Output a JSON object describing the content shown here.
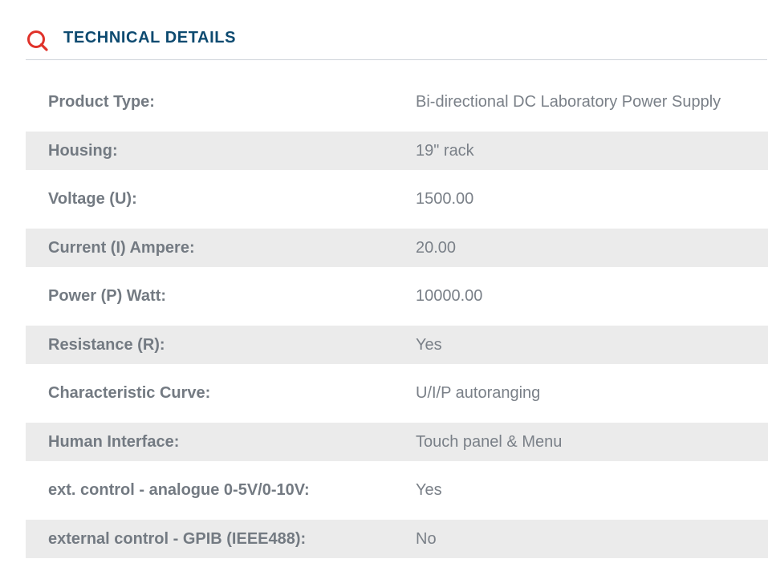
{
  "header": {
    "title": "TECHNICAL DETAILS",
    "icon": "search-icon",
    "icon_color": "#e0322a",
    "title_color": "#0d4a70"
  },
  "details": [
    {
      "label": "Product Type:",
      "value": "Bi-directional DC Laboratory Power Supply"
    },
    {
      "label": "Housing:",
      "value": "19\" rack"
    },
    {
      "label": "Voltage (U):",
      "value": "1500.00"
    },
    {
      "label": "Current (I) Ampere:",
      "value": "20.00"
    },
    {
      "label": "Power (P) Watt:",
      "value": "10000.00"
    },
    {
      "label": "Resistance (R):",
      "value": "Yes"
    },
    {
      "label": "Characteristic Curve:",
      "value": "U/I/P autoranging"
    },
    {
      "label": "Human Interface:",
      "value": "Touch panel & Menu"
    },
    {
      "label": "ext. control - analogue 0-5V/0-10V:",
      "value": "Yes"
    },
    {
      "label": "external control - GPIB (IEEE488):",
      "value": "No"
    }
  ]
}
